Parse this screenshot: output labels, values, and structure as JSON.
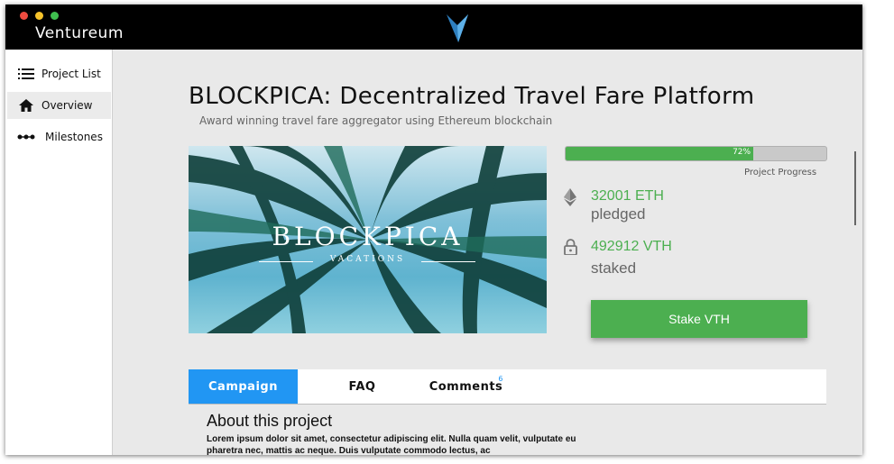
{
  "window": {
    "app_name": "Ventureum"
  },
  "sidebar": {
    "items": [
      {
        "label": "Project List",
        "icon": "list-icon"
      },
      {
        "label": "Overview",
        "icon": "home-icon"
      },
      {
        "label": "Milestones",
        "icon": "milestones-icon"
      }
    ],
    "active_index": 1
  },
  "project": {
    "title": "BLOCKPICA: Decentralized Travel Fare Platform",
    "subtitle": "Award winning travel fare aggregator using Ethereum blockchain",
    "image": {
      "brand": "BLOCKPICA",
      "tagline": "VACATIONS"
    },
    "progress": {
      "value": 0.72,
      "label_text": "72%",
      "caption": "Project Progress"
    },
    "pledged": {
      "value": "32001 ETH",
      "label": "pledged",
      "icon": "ethereum-icon"
    },
    "staked": {
      "value": "492912 VTH",
      "label": "staked",
      "icon": "lock-icon"
    },
    "stake_button": "Stake VTH"
  },
  "tabs": [
    {
      "label": "Campaign",
      "active": true
    },
    {
      "label": "FAQ",
      "active": false
    },
    {
      "label": "Comments",
      "active": false,
      "badge": "6"
    }
  ],
  "about": {
    "title": "About this project",
    "body": "Lorem ipsum dolor sit amet, consectetur adipiscing elit. Nulla quam velit, vulputate eu pharetra nec, mattis ac neque. Duis vulputate commodo lectus, ac"
  },
  "colors": {
    "accent_green": "#4caf50",
    "accent_blue": "#2196f3",
    "titlebar": "#000000"
  }
}
